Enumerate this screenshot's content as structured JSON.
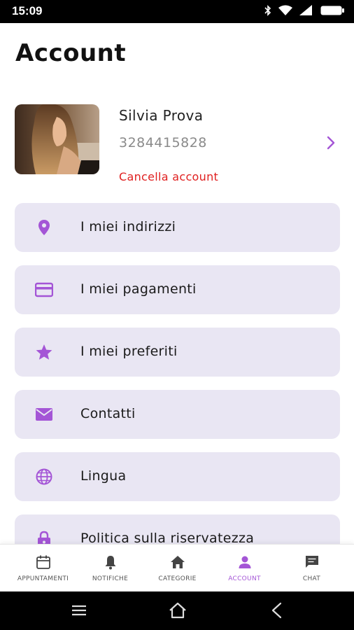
{
  "status_bar": {
    "time": "15:09",
    "icons": [
      "bluetooth-icon",
      "wifi-icon",
      "signal-icon",
      "battery-icon"
    ]
  },
  "page": {
    "title": "Account"
  },
  "profile": {
    "name": "Silvia Prova",
    "phone": "3284415828",
    "delete_label": "Cancella account"
  },
  "menu": [
    {
      "label": "I miei indirizzi",
      "icon": "location-pin-icon"
    },
    {
      "label": "I miei pagamenti",
      "icon": "credit-card-icon"
    },
    {
      "label": "I miei preferiti",
      "icon": "star-icon"
    },
    {
      "label": "Contatti",
      "icon": "envelope-icon"
    },
    {
      "label": "Lingua",
      "icon": "globe-icon"
    },
    {
      "label": "Politica sulla riservatezza",
      "icon": "lock-icon"
    }
  ],
  "tabs": [
    {
      "label": "APPUNTAMENTI",
      "icon": "calendar-icon",
      "active": false
    },
    {
      "label": "NOTIFICHE",
      "icon": "bell-icon",
      "active": false
    },
    {
      "label": "CATEGORIE",
      "icon": "home-icon",
      "active": false
    },
    {
      "label": "ACCOUNT",
      "icon": "person-icon",
      "active": true
    },
    {
      "label": "CHAT",
      "icon": "chat-icon",
      "active": false
    }
  ],
  "colors": {
    "accent": "#a455d6",
    "danger": "#e02020",
    "menu_bg": "#e9e6f3"
  }
}
